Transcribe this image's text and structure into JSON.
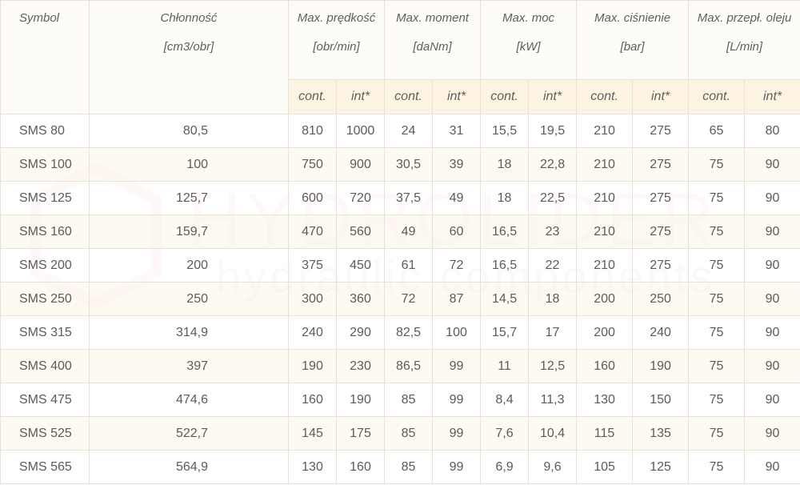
{
  "watermark": {
    "brand": "HYDROLIDER",
    "tagline": "hydraulic components"
  },
  "table": {
    "headers": {
      "symbol": "Symbol",
      "chlonnosc": {
        "label": "Chłonność",
        "unit": "[cm3/obr]"
      },
      "groups": [
        {
          "label": "Max. prędkość",
          "unit": "[obr/min]"
        },
        {
          "label": "Max. moment",
          "unit": "[daNm]"
        },
        {
          "label": "Max. moc",
          "unit": "[kW]"
        },
        {
          "label": "Max. ciśnienie",
          "unit": "[bar]"
        },
        {
          "label": "Max. przepł. oleju",
          "unit": "[L/min]"
        }
      ],
      "sub": [
        "cont.",
        "int*",
        "cont.",
        "int*",
        "cont.",
        "int*",
        "cont.",
        "int*",
        "cont.",
        "int*"
      ]
    },
    "rows": [
      [
        "SMS 80",
        "80,5",
        "810",
        "1000",
        "24",
        "31",
        "15,5",
        "19,5",
        "210",
        "275",
        "65",
        "80"
      ],
      [
        "SMS 100",
        "100",
        "750",
        "900",
        "30,5",
        "39",
        "18",
        "22,8",
        "210",
        "275",
        "75",
        "90"
      ],
      [
        "SMS 125",
        "125,7",
        "600",
        "720",
        "37,5",
        "49",
        "18",
        "22,5",
        "210",
        "275",
        "75",
        "90"
      ],
      [
        "SMS 160",
        "159,7",
        "470",
        "560",
        "49",
        "60",
        "16,5",
        "23",
        "210",
        "275",
        "75",
        "90"
      ],
      [
        "SMS 200",
        "200",
        "375",
        "450",
        "61",
        "72",
        "16,5",
        "22",
        "210",
        "275",
        "75",
        "90"
      ],
      [
        "SMS 250",
        "250",
        "300",
        "360",
        "72",
        "87",
        "14,5",
        "18",
        "200",
        "250",
        "75",
        "90"
      ],
      [
        "SMS 315",
        "314,9",
        "240",
        "290",
        "82,5",
        "100",
        "15,7",
        "17",
        "200",
        "240",
        "75",
        "90"
      ],
      [
        "SMS 400",
        "397",
        "190",
        "230",
        "86,5",
        "99",
        "11",
        "12,5",
        "160",
        "190",
        "75",
        "90"
      ],
      [
        "SMS 475",
        "474,6",
        "160",
        "190",
        "85",
        "99",
        "8,4",
        "11,3",
        "130",
        "150",
        "75",
        "90"
      ],
      [
        "SMS 525",
        "522,7",
        "145",
        "175",
        "85",
        "99",
        "7,6",
        "10,4",
        "115",
        "135",
        "75",
        "90"
      ],
      [
        "SMS 565",
        "564,9",
        "130",
        "160",
        "85",
        "99",
        "6,9",
        "9,6",
        "105",
        "125",
        "75",
        "90"
      ]
    ]
  }
}
